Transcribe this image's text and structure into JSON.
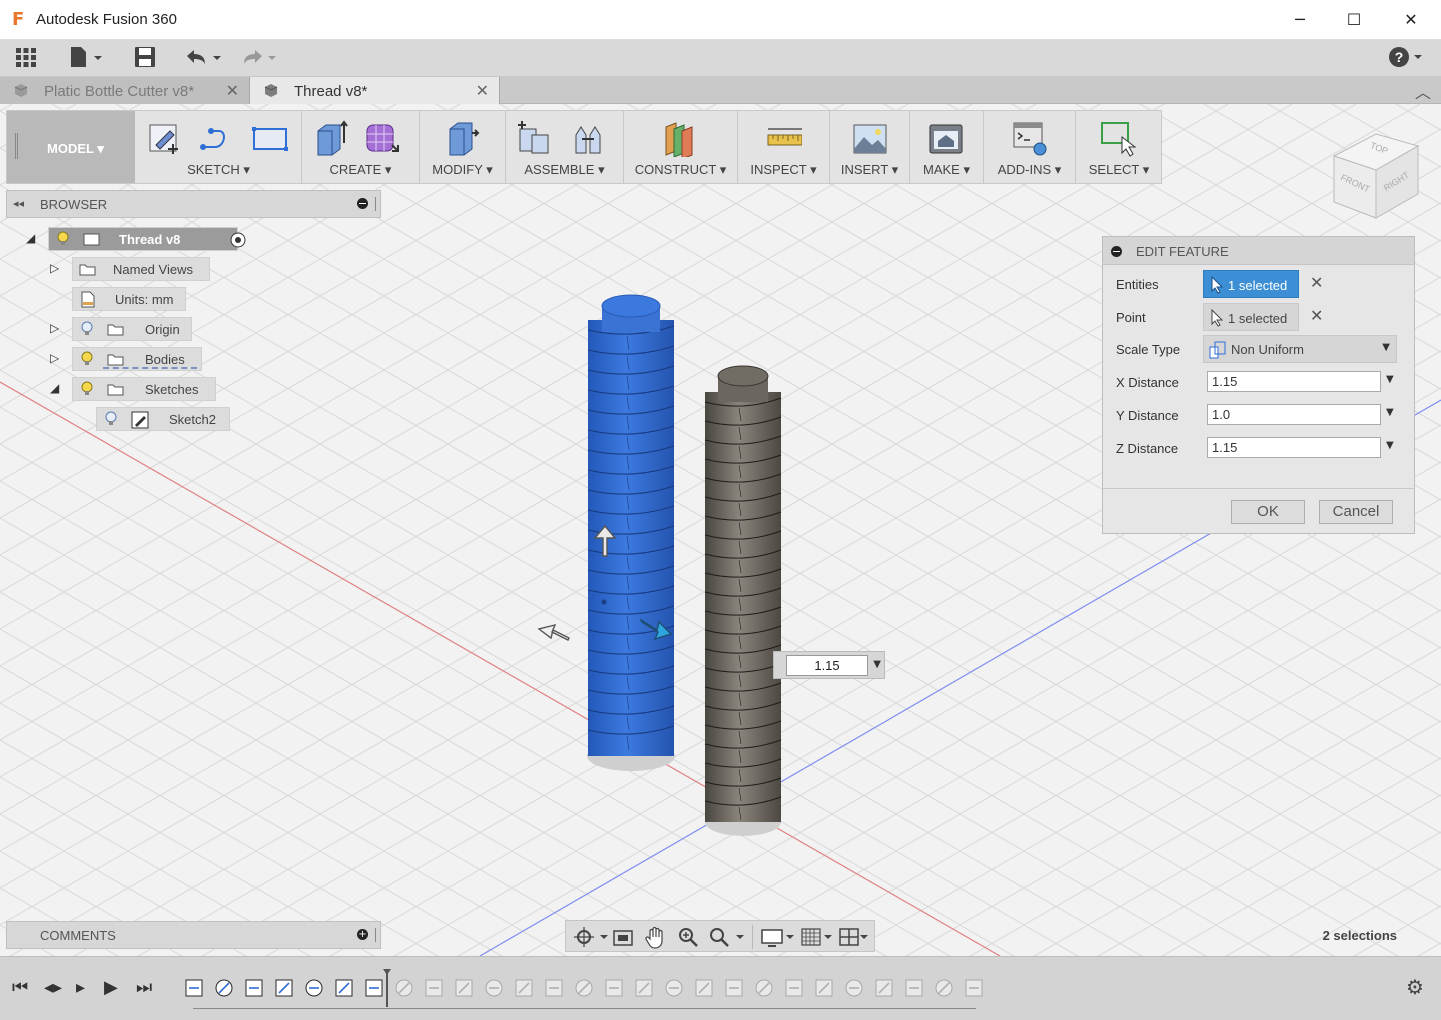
{
  "window": {
    "title": "Autodesk Fusion 360",
    "app_logo": "F",
    "minimize_glyph": "─",
    "maximize_glyph": "☐",
    "close_glyph": "✕"
  },
  "quick_access": {
    "icons": [
      "app-grid-icon",
      "file-icon",
      "save-icon",
      "undo-icon",
      "redo-icon",
      "help-icon"
    ],
    "help_glyph": "?"
  },
  "tabs": [
    {
      "label": "Platic Bottle Cutter v8*",
      "active": false
    },
    {
      "label": "Thread v8*",
      "active": true
    }
  ],
  "toolbar": {
    "workspace": "MODEL ▾",
    "groups": [
      {
        "label": "SKETCH ▾"
      },
      {
        "label": "CREATE ▾"
      },
      {
        "label": "MODIFY ▾"
      },
      {
        "label": "ASSEMBLE ▾"
      },
      {
        "label": "CONSTRUCT ▾"
      },
      {
        "label": "INSPECT ▾"
      },
      {
        "label": "INSERT ▾"
      },
      {
        "label": "MAKE ▾"
      },
      {
        "label": "ADD-INS ▾"
      },
      {
        "label": "SELECT ▾"
      }
    ]
  },
  "browser": {
    "title": "BROWSER",
    "collapse_glyph": "◂◂",
    "items": [
      {
        "label": "Thread v8",
        "expander": "◢"
      },
      {
        "label": "Named Views",
        "expander": "▷"
      },
      {
        "label": "Units: mm",
        "expander": ""
      },
      {
        "label": "Origin",
        "expander": "▷"
      },
      {
        "label": "Bodies",
        "expander": "▷"
      },
      {
        "label": "Sketches",
        "expander": "◢"
      },
      {
        "label": "Sketch2",
        "expander": ""
      }
    ]
  },
  "comments": {
    "title": "COMMENTS",
    "plus_glyph": "+"
  },
  "navbar": {
    "icons": [
      "orbit-icon",
      "look-at-icon",
      "pan-icon",
      "zoom-icon",
      "fit-icon",
      "display-settings-icon",
      "grid-settings-icon",
      "viewports-icon"
    ]
  },
  "status": {
    "selections": "2 selections"
  },
  "viewcube": {
    "top": "TOP",
    "front": "FRONT",
    "right": "RIGHT"
  },
  "edit_feature": {
    "title": "EDIT FEATURE",
    "entities_label": "Entities",
    "entities_value": "1 selected",
    "point_label": "Point",
    "point_value": "1 selected",
    "scale_type_label": "Scale Type",
    "scale_type_value": "Non Uniform",
    "x_label": "X Distance",
    "x_value": "1.15",
    "y_label": "Y Distance",
    "y_value": "1.0",
    "z_label": "Z Distance",
    "z_value": "1.15",
    "ok": "OK",
    "cancel": "Cancel",
    "clear_glyph": "✕",
    "caret_glyph": "▼"
  },
  "manipulator": {
    "value": "1.15"
  },
  "timeline": {
    "controls": [
      "⏮",
      "◂▸",
      "▸",
      "▶",
      "⏭"
    ],
    "settings_glyph": "⚙"
  },
  "colors": {
    "selected_body": "#2f6fd6",
    "other_body": "#6d6860",
    "accent_blue": "#3c8fd4",
    "x_axis": "#e06060",
    "y_axis": "#5f78e8"
  }
}
